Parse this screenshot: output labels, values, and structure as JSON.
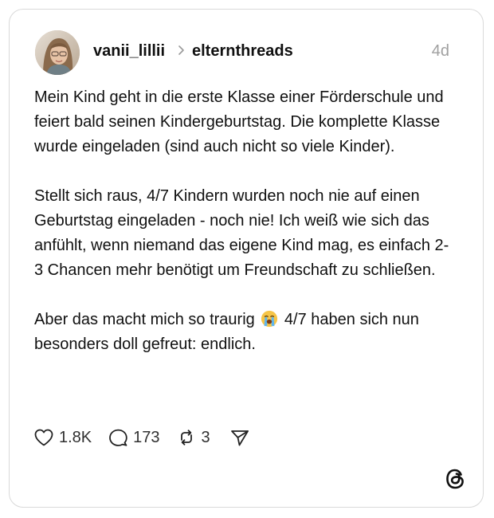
{
  "post": {
    "author": "vanii_lillii",
    "community": "elternthreads",
    "time": "4d",
    "paragraphs": {
      "p1": "Mein Kind geht in die erste Klasse einer Förderschule und feiert bald seinen Kindergeburtstag. Die komplette Klasse wurde eingeladen (sind auch nicht so viele Kinder).",
      "p2": "Stellt sich raus, 4/7 Kindern wurden noch nie auf einen Geburtstag eingeladen - noch nie! Ich weiß wie sich das anfühlt, wenn niemand das eigene Kind mag, es einfach 2-3 Chancen mehr benötigt um Freundschaft zu schließen.",
      "p3_before_emoji": "Aber das macht mich so traurig",
      "p3_emoji_name": "loudly-crying-face",
      "p3_after_emoji": "4/7 haben sich nun besonders doll gefreut: endlich."
    },
    "stats": {
      "likes": "1.8K",
      "replies": "173",
      "reposts": "3"
    }
  },
  "icons": {
    "separator": "chevron-right-icon",
    "like": "heart-icon",
    "reply": "speech-bubble-icon",
    "repost": "repost-icon",
    "share": "paper-plane-icon",
    "logo": "threads-logo-icon"
  },
  "colors": {
    "text": "#101010",
    "muted": "#a0a0a0",
    "border": "#d9d9d9"
  }
}
